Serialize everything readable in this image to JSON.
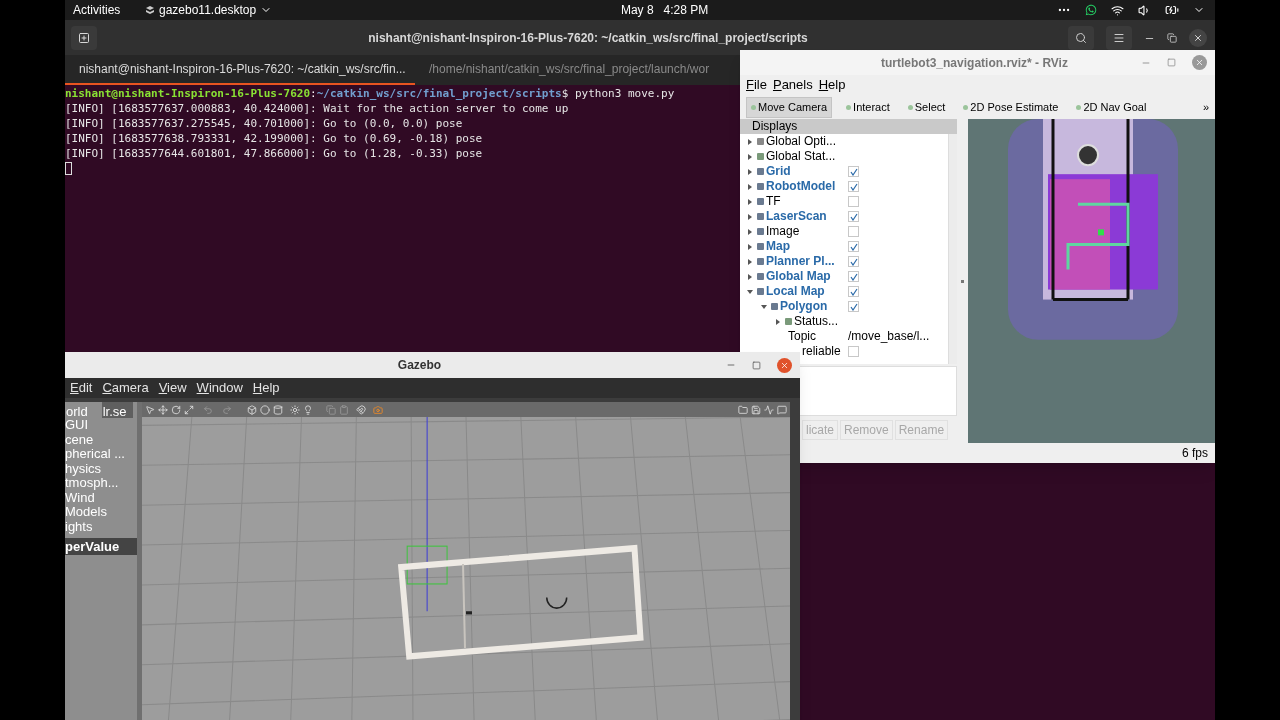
{
  "top_bar": {
    "activities": "Activities",
    "app": "gazebo11.desktop",
    "date": "May 8",
    "time": "4:28 PM"
  },
  "terminal": {
    "title": "nishant@nishant-Inspiron-16-Plus-7620: ~/catkin_ws/src/final_project/scripts",
    "tabs": [
      {
        "label": "nishant@nishant-Inspiron-16-Plus-7620: ~/catkin_ws/src/fin...",
        "selected": true
      },
      {
        "label": "/home/nishant/catkin_ws/src/final_project/launch/wor",
        "selected": false
      }
    ],
    "prompt": {
      "user": "nishant@nishant-Inspiron-16-Plus-7620",
      "separator": ":",
      "path": "~/catkin_ws/src/final_project/scripts",
      "command": "$ python3 move.py"
    },
    "lines": [
      "[INFO] [1683577637.000883, 40.424000]: Wait for the action server to come up",
      "[INFO] [1683577637.275545, 40.701000]: Go to (0.0, 0.0) pose",
      "[INFO] [1683577638.793331, 42.199000]: Go to (0.69, -0.18) pose",
      "[INFO] [1683577644.601801, 47.866000]: Go to (1.28, -0.33) pose"
    ]
  },
  "rviz": {
    "title": "turtlebot3_navigation.rviz* - RViz",
    "menu": [
      "File",
      "Panels",
      "Help"
    ],
    "tools": [
      {
        "label": "Move Camera",
        "selected": true
      },
      {
        "label": "Interact",
        "selected": false
      },
      {
        "label": "Select",
        "selected": false
      },
      {
        "label": "2D Pose Estimate",
        "selected": false
      },
      {
        "label": "2D Nav Goal",
        "selected": false
      }
    ],
    "more": "»",
    "displays": {
      "header": "Displays",
      "items": [
        {
          "label": "Global Opti...",
          "kind": "group",
          "expanded": false
        },
        {
          "label": "Global Stat...",
          "kind": "status",
          "expanded": false
        },
        {
          "label": "Grid",
          "kind": "display",
          "expanded": false,
          "checked": true
        },
        {
          "label": "RobotModel",
          "kind": "display",
          "expanded": false,
          "checked": true
        },
        {
          "label": "TF",
          "kind": "display",
          "expanded": false,
          "checked": false
        },
        {
          "label": "LaserScan",
          "kind": "display",
          "expanded": false,
          "checked": true
        },
        {
          "label": "Image",
          "kind": "display",
          "expanded": false,
          "checked": false
        },
        {
          "label": "Map",
          "kind": "display",
          "expanded": false,
          "checked": true
        },
        {
          "label": "Planner Pl...",
          "kind": "display",
          "expanded": false,
          "checked": true
        },
        {
          "label": "Global Map",
          "kind": "display",
          "expanded": false,
          "checked": true
        },
        {
          "label": "Local Map",
          "kind": "display",
          "expanded": true,
          "checked": true,
          "children": [
            {
              "label": "Polygon",
              "kind": "display",
              "expanded": true,
              "checked": true,
              "children": [
                {
                  "label": "Status...",
                  "kind": "status",
                  "expanded": false
                },
                {
                  "label": "Topic",
                  "kind": "property",
                  "value": "/move_base/l..."
                },
                {
                  "label": "reliable",
                  "kind": "bool_property",
                  "checked": false
                }
              ]
            }
          ]
        }
      ]
    },
    "buttons": [
      {
        "label": "licate",
        "disabled": true
      },
      {
        "label": "Remove",
        "disabled": true
      },
      {
        "label": "Rename",
        "disabled": true
      }
    ],
    "fps": "6 fps"
  },
  "gazebo": {
    "title": "Gazebo",
    "menu": [
      "Edit",
      "Camera",
      "View",
      "Window",
      "Help"
    ],
    "tabs": [
      {
        "label": "orld",
        "selected": true
      },
      {
        "label": "lr.se",
        "selected": false
      }
    ],
    "items": [
      {
        "label": "GUI",
        "selected": false
      },
      {
        "label": "cene",
        "selected": false
      },
      {
        "label": "pherical ...",
        "selected": false
      },
      {
        "label": "hysics",
        "selected": false
      },
      {
        "label": "tmosph...",
        "selected": false
      },
      {
        "label": "Wind",
        "selected": false
      },
      {
        "label": "Models",
        "selected": false
      },
      {
        "label": "ights",
        "selected": false
      },
      {
        "label": "perValue",
        "selected": true
      }
    ]
  }
}
